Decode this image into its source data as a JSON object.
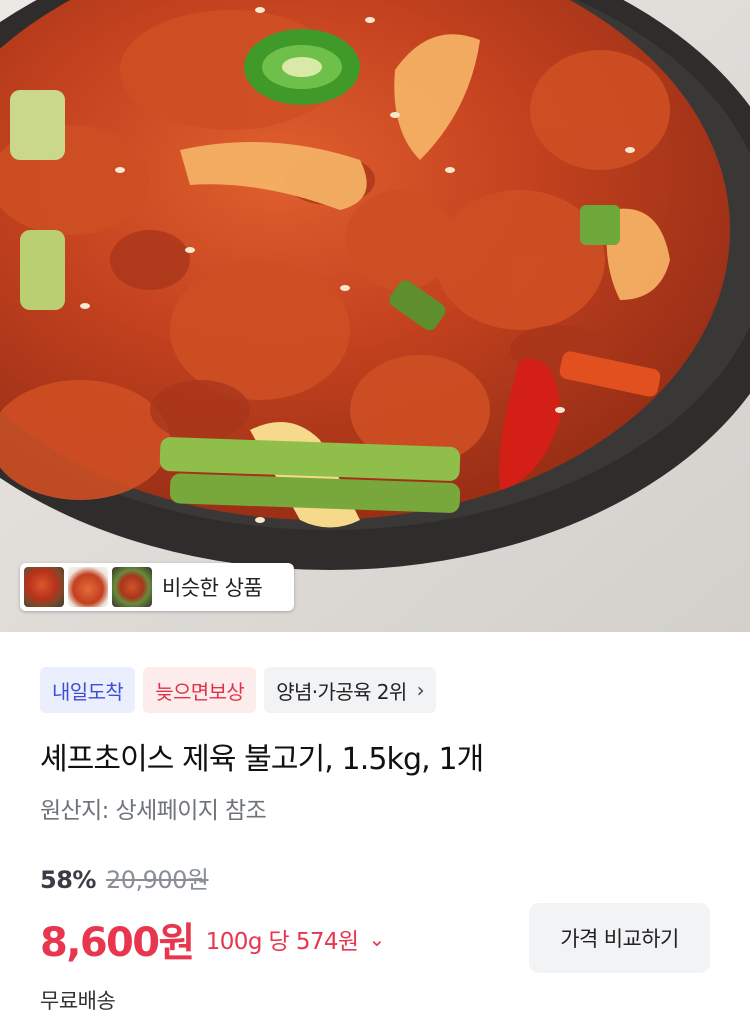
{
  "hero": {
    "image_name": "stir-fried spicy pork in black stone bowl",
    "similar_label": "비슷한 상품"
  },
  "tags": [
    {
      "label": "내일도착"
    },
    {
      "label": "늦으면보상"
    },
    {
      "label": "양념·가공육 2위",
      "chevron": "›"
    }
  ],
  "product": {
    "title": "셰프초이스 제육 불고기, 1.5kg, 1개",
    "origin": "원산지: 상세페이지 참조",
    "discount": "58%",
    "original_price": "20,900원",
    "price": "8,600원",
    "unit_price": "100g 당 574원",
    "unit_chevron": "⌄",
    "compare_button": "가격 비교하기",
    "shipping": "무료배송"
  },
  "colors": {
    "price_red": "#e8364f",
    "tag_blue_text": "#3d4fd6",
    "tag_red_text": "#e0334a"
  }
}
